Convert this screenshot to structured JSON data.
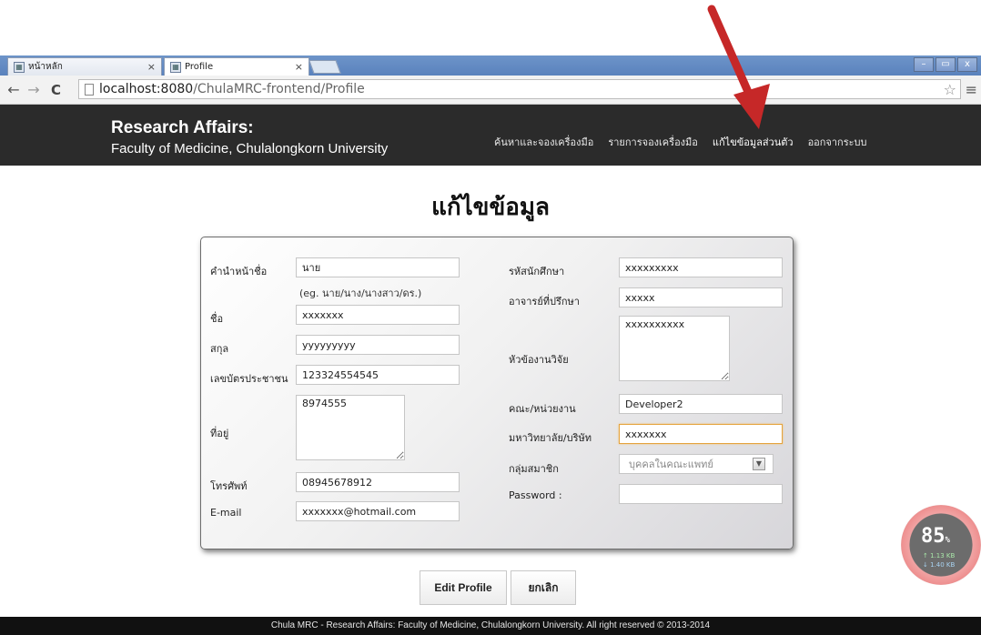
{
  "browser": {
    "tabs": [
      {
        "label": "หน้าหลัก",
        "close": "×"
      },
      {
        "label": "Profile",
        "close": "×"
      }
    ],
    "window_controls": [
      "–",
      "▭",
      "x"
    ],
    "url_host": "localhost:8080",
    "url_path": "/ChulaMRC-frontend/Profile"
  },
  "header": {
    "title": "Research Affairs:",
    "subtitle": "Faculty of Medicine, Chulalongkorn University",
    "nav": [
      {
        "label": "ค้นหาและจองเครื่องมือ"
      },
      {
        "label": "รายการจองเครื่องมือ"
      },
      {
        "label": "แก้ไขข้อมูลส่วนตัว"
      },
      {
        "label": "ออกจากระบบ"
      }
    ]
  },
  "page": {
    "heading": "แก้ไขข้อมูล"
  },
  "form": {
    "left": {
      "prefix_label": "คำนำหน้าชื่อ",
      "prefix_value": "นาย",
      "prefix_hint": "(eg. นาย/นาง/นางสาว/ดร.)",
      "name_label": "ชื่อ",
      "name_value": "xxxxxxx",
      "surname_label": "สกุล",
      "surname_value": "yyyyyyyyy",
      "id_label": "เลขบัตรประชาชน",
      "id_value": "123324554545",
      "address_label": "ที่อยู่",
      "address_value": "8974555",
      "phone_label": "โทรศัพท์",
      "phone_value": "08945678912",
      "email_label": "E-mail",
      "email_value": "xxxxxxx@hotmail.com"
    },
    "right": {
      "student_id_label": "รหัสนักศึกษา",
      "student_id_value": "xxxxxxxxx",
      "advisor_label": "อาจารย์ที่ปรึกษา",
      "advisor_value": "xxxxx",
      "topic_label": "หัวข้องานวิจัย",
      "topic_value": "xxxxxxxxxx",
      "faculty_label": "คณะ/หน่วยงาน",
      "faculty_value": "Developer2",
      "university_label": "มหาวิทยาลัย/บริษัท",
      "university_value": "xxxxxxx",
      "group_label": "กลุ่มสมาชิก",
      "group_value": "บุคคลในคณะแพทย์",
      "password_label": "Password :",
      "password_value": ""
    }
  },
  "buttons": {
    "edit": "Edit Profile",
    "cancel": "ยกเลิก"
  },
  "footer": {
    "text": "Chula MRC - Research Affairs: Faculty of Medicine, Chulalongkorn University. All right reserved © 2013-2014"
  },
  "bandwidth": {
    "percent": "85",
    "percent_sign": "%",
    "upload": "↑ 1.13 KB",
    "download": "↓ 1.40 KB"
  }
}
